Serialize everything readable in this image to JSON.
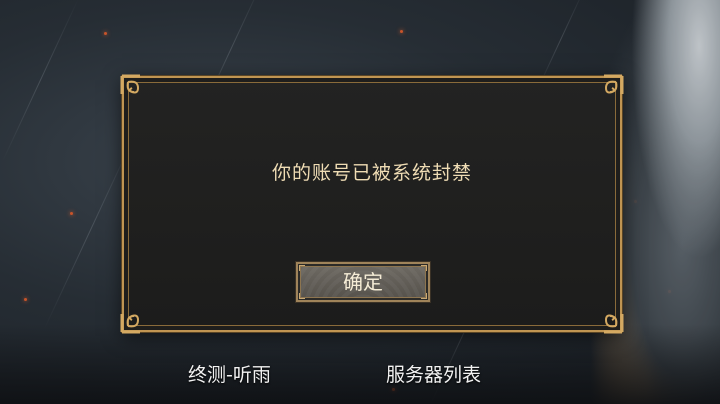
{
  "dialog": {
    "message": "你的账号已被系统封禁",
    "confirm_label": "确定"
  },
  "footer": {
    "server_name": "终测-听雨",
    "server_list_label": "服务器列表"
  },
  "colors": {
    "frame_gold": "#c09552",
    "message_text": "#efdcb4",
    "button_face": "#615d57"
  },
  "icons": [
    "ornate-corner-icon"
  ]
}
